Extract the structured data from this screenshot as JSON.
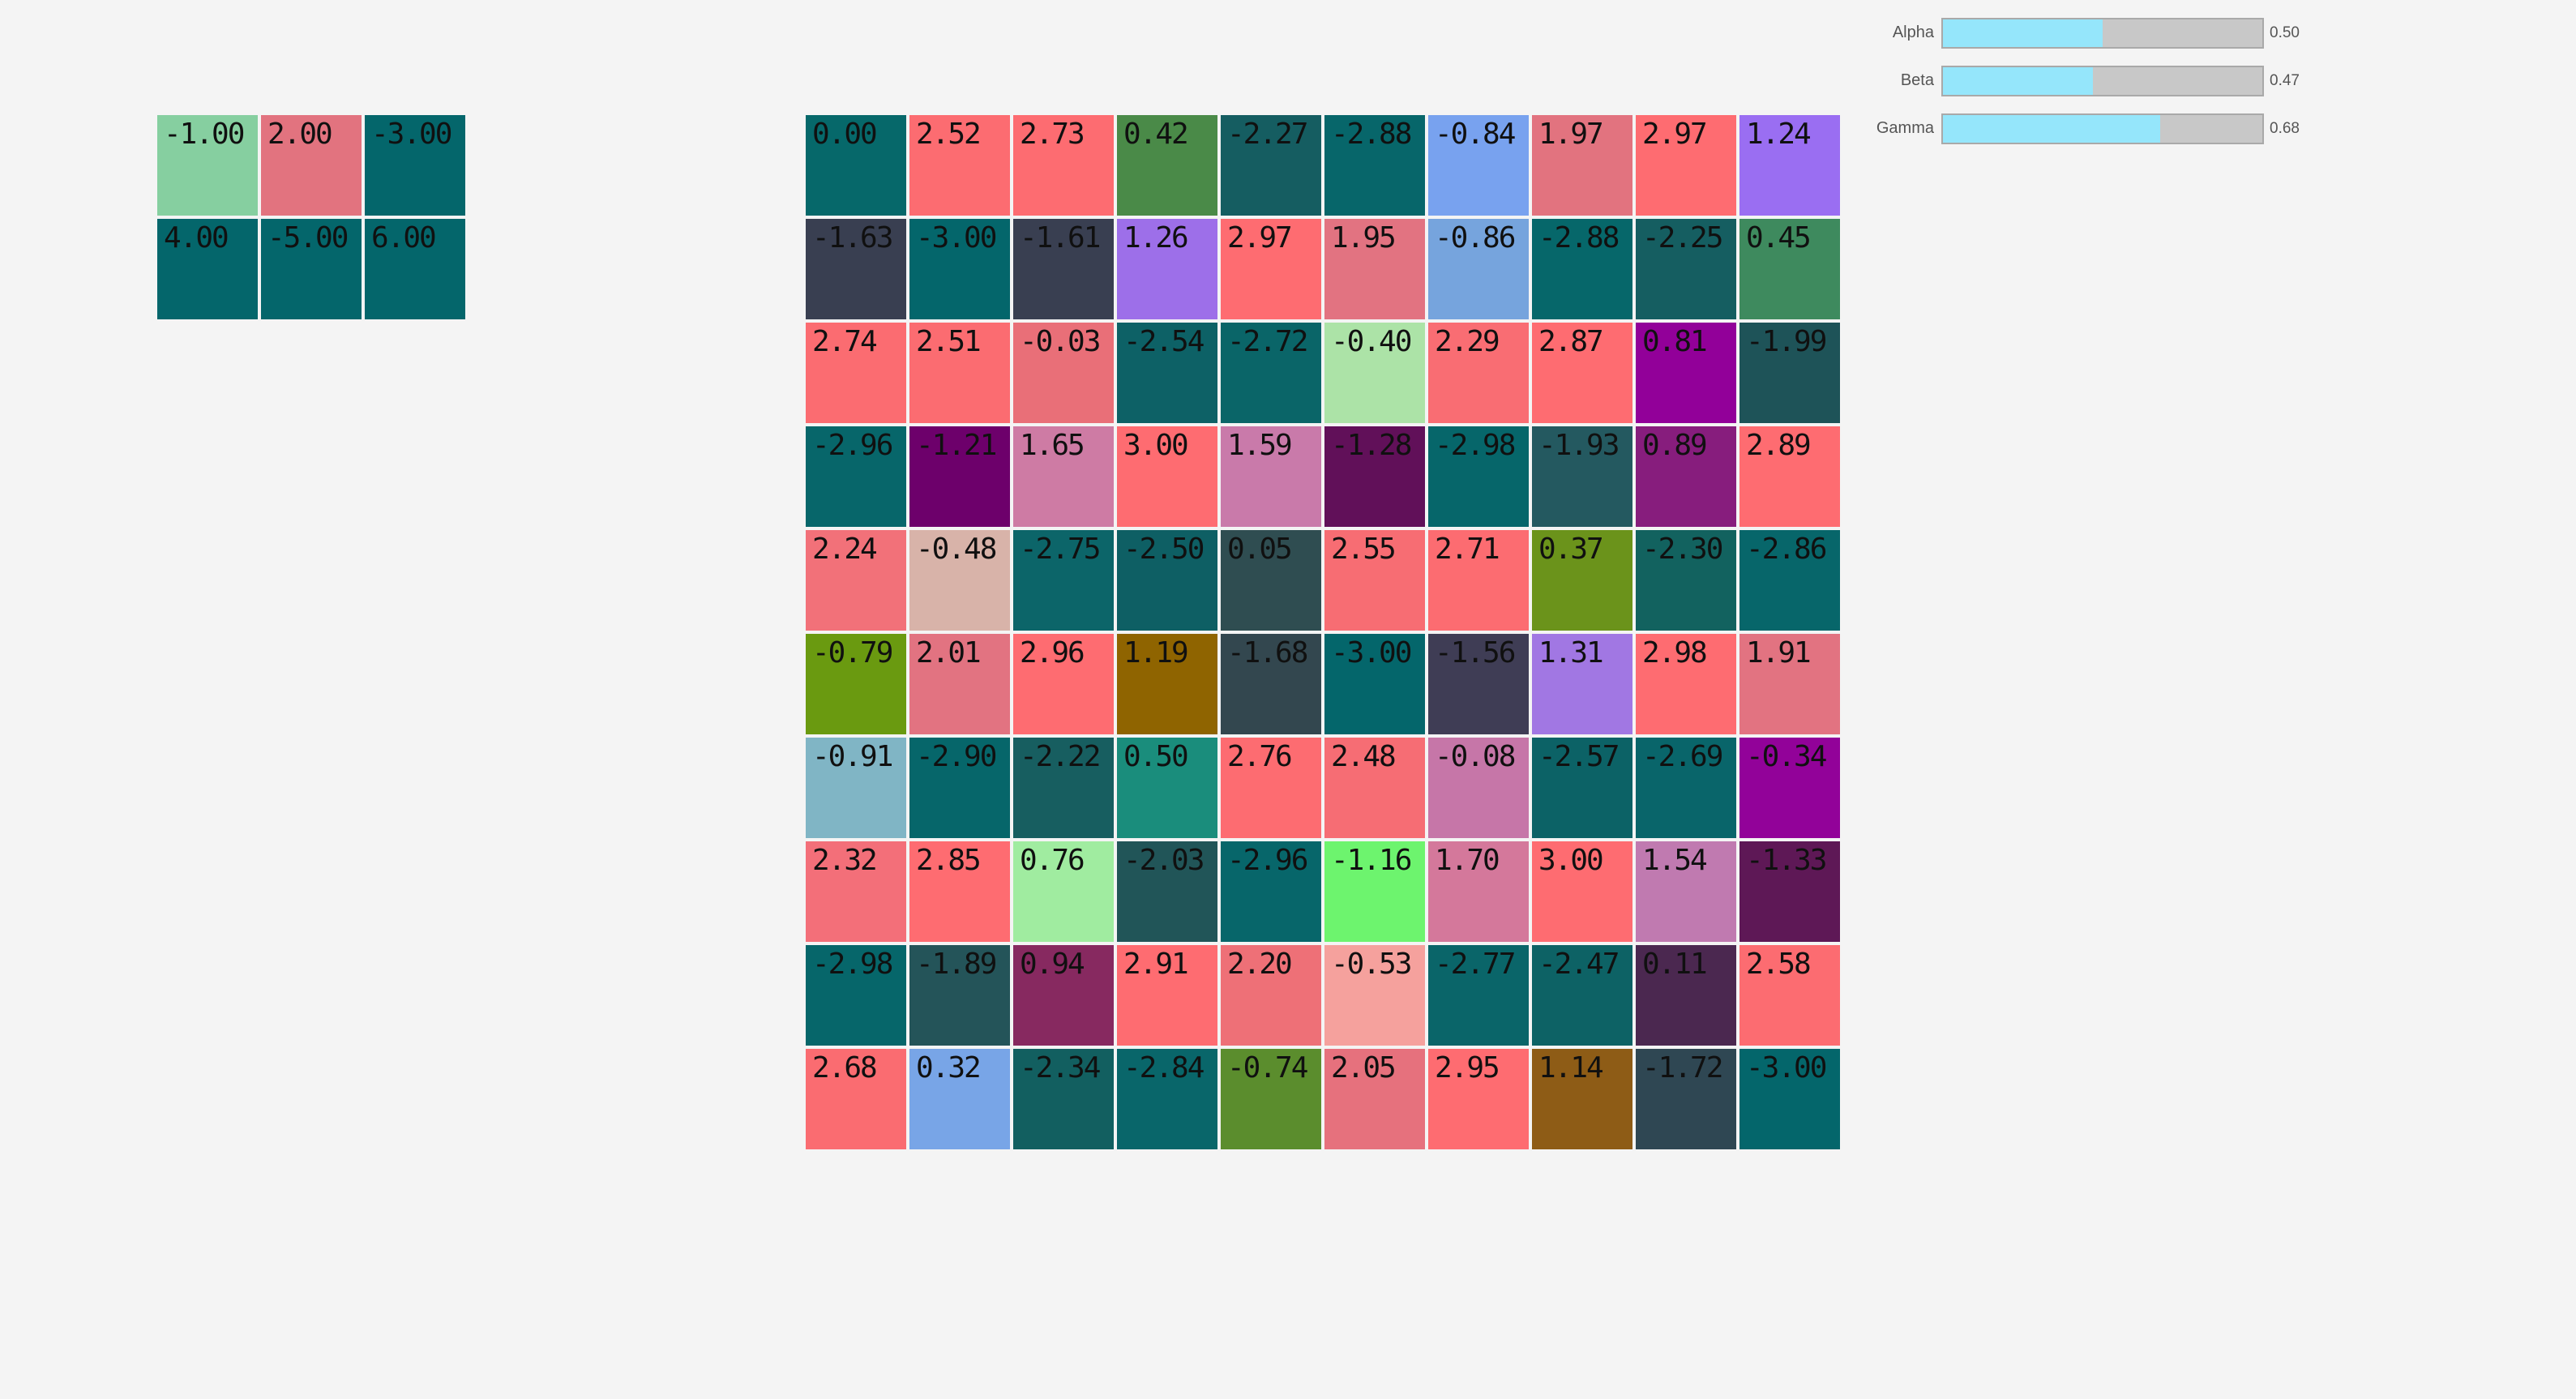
{
  "sliders": [
    {
      "label": "Alpha",
      "value_text": "0.50",
      "value": 0.5
    },
    {
      "label": "Beta",
      "value_text": "0.47",
      "value": 0.47
    },
    {
      "label": "Gamma",
      "value_text": "0.68",
      "value": 0.68
    }
  ],
  "small_matrix": {
    "rows": [
      [
        {
          "text": "-1.00",
          "color": "#86cfa0"
        },
        {
          "text": "2.00",
          "color": "#e2737f"
        },
        {
          "text": "-3.00",
          "color": "#04666b"
        }
      ],
      [
        {
          "text": "4.00",
          "color": "#04666b"
        },
        {
          "text": "-5.00",
          "color": "#04666b"
        },
        {
          "text": "6.00",
          "color": "#04666b"
        }
      ]
    ]
  },
  "big_matrix": {
    "rows": [
      [
        {
          "text": "0.00",
          "color": "#06686a"
        },
        {
          "text": "2.52",
          "color": "#fc6c71"
        },
        {
          "text": "2.73",
          "color": "#fd6c71"
        },
        {
          "text": "0.42",
          "color": "#4a8a48"
        },
        {
          "text": "-2.27",
          "color": "#155d61"
        },
        {
          "text": "-2.88",
          "color": "#07666a"
        },
        {
          "text": "-0.84",
          "color": "#78a2ef"
        },
        {
          "text": "1.97",
          "color": "#e2737f"
        },
        {
          "text": "2.97",
          "color": "#fe6c71"
        },
        {
          "text": "1.24",
          "color": "#9a6ef2"
        }
      ],
      [
        {
          "text": "-1.63",
          "color": "#393f51"
        },
        {
          "text": "-3.00",
          "color": "#04666b"
        },
        {
          "text": "-1.61",
          "color": "#393f51"
        },
        {
          "text": "1.26",
          "color": "#9d6fe9"
        },
        {
          "text": "2.97",
          "color": "#fe6c71"
        },
        {
          "text": "1.95",
          "color": "#e27381"
        },
        {
          "text": "-0.86",
          "color": "#76a4dd"
        },
        {
          "text": "-2.88",
          "color": "#06676a"
        },
        {
          "text": "-2.25",
          "color": "#155e61"
        },
        {
          "text": "0.45",
          "color": "#3e8a5e"
        }
      ],
      [
        {
          "text": "2.74",
          "color": "#fb6c71"
        },
        {
          "text": "2.51",
          "color": "#fb6c71"
        },
        {
          "text": "-0.03",
          "color": "#e96f78"
        },
        {
          "text": "-2.54",
          "color": "#0d6166"
        },
        {
          "text": "-2.72",
          "color": "#0a6568"
        },
        {
          "text": "-0.40",
          "color": "#ace3a7"
        },
        {
          "text": "2.29",
          "color": "#f96d73"
        },
        {
          "text": "2.87",
          "color": "#fe6c71"
        },
        {
          "text": "0.81",
          "color": "#920099"
        },
        {
          "text": "-1.99",
          "color": "#1e5358"
        }
      ],
      [
        {
          "text": "-2.96",
          "color": "#07666a"
        },
        {
          "text": "-1.21",
          "color": "#6d006b"
        },
        {
          "text": "1.65",
          "color": "#ce7ba4"
        },
        {
          "text": "3.00",
          "color": "#fe6c71"
        },
        {
          "text": "1.59",
          "color": "#c97aaa"
        },
        {
          "text": "-1.28",
          "color": "#611059"
        },
        {
          "text": "-2.98",
          "color": "#06666a"
        },
        {
          "text": "-1.93",
          "color": "#245960"
        },
        {
          "text": "0.89",
          "color": "#871d7d"
        },
        {
          "text": "2.89",
          "color": "#fe6c71"
        }
      ],
      [
        {
          "text": "2.24",
          "color": "#f27179"
        },
        {
          "text": "-0.48",
          "color": "#d8b3a9"
        },
        {
          "text": "-2.75",
          "color": "#0c6569"
        },
        {
          "text": "-2.50",
          "color": "#0e5f64"
        },
        {
          "text": "0.05",
          "color": "#2f4d51"
        },
        {
          "text": "2.55",
          "color": "#f76d73"
        },
        {
          "text": "2.71",
          "color": "#fc6c71"
        },
        {
          "text": "0.37",
          "color": "#6b931b"
        },
        {
          "text": "-2.30",
          "color": "#12625f"
        },
        {
          "text": "-2.86",
          "color": "#07666a"
        }
      ],
      [
        {
          "text": "-0.79",
          "color": "#6a9a10"
        },
        {
          "text": "2.01",
          "color": "#e27381"
        },
        {
          "text": "2.96",
          "color": "#fe6c71"
        },
        {
          "text": "1.19",
          "color": "#8f6400"
        },
        {
          "text": "-1.68",
          "color": "#33474f"
        },
        {
          "text": "-3.00",
          "color": "#04666b"
        },
        {
          "text": "-1.56",
          "color": "#3f3d55"
        },
        {
          "text": "1.31",
          "color": "#a177e3"
        },
        {
          "text": "2.98",
          "color": "#fe6c71"
        },
        {
          "text": "1.91",
          "color": "#e27381"
        }
      ],
      [
        {
          "text": "-0.91",
          "color": "#80b5c5"
        },
        {
          "text": "-2.90",
          "color": "#06666a"
        },
        {
          "text": "-2.22",
          "color": "#175e60"
        },
        {
          "text": "0.50",
          "color": "#1a8d7c"
        },
        {
          "text": "2.76",
          "color": "#fd6c71"
        },
        {
          "text": "2.48",
          "color": "#f66d74"
        },
        {
          "text": "-0.08",
          "color": "#c676a8"
        },
        {
          "text": "-2.57",
          "color": "#0c6266"
        },
        {
          "text": "-2.69",
          "color": "#09656a"
        },
        {
          "text": "-0.34",
          "color": "#920299"
        }
      ],
      [
        {
          "text": "2.32",
          "color": "#f36f79"
        },
        {
          "text": "2.85",
          "color": "#fe6c71"
        },
        {
          "text": "0.76",
          "color": "#a0eca0"
        },
        {
          "text": "-2.03",
          "color": "#215558"
        },
        {
          "text": "-2.96",
          "color": "#07666a"
        },
        {
          "text": "-1.16",
          "color": "#6df46e"
        },
        {
          "text": "1.70",
          "color": "#d4789b"
        },
        {
          "text": "3.00",
          "color": "#fe6c71"
        },
        {
          "text": "1.54",
          "color": "#c07ab0"
        },
        {
          "text": "-1.33",
          "color": "#5e1856"
        }
      ],
      [
        {
          "text": "-2.98",
          "color": "#06666a"
        },
        {
          "text": "-1.89",
          "color": "#245459"
        },
        {
          "text": "0.94",
          "color": "#872960"
        },
        {
          "text": "2.91",
          "color": "#fe6c71"
        },
        {
          "text": "2.20",
          "color": "#ee7077"
        },
        {
          "text": "-0.53",
          "color": "#f5a19d"
        },
        {
          "text": "-2.77",
          "color": "#0a6569"
        },
        {
          "text": "-2.47",
          "color": "#0d6265"
        },
        {
          "text": "0.11",
          "color": "#4b2850"
        },
        {
          "text": "2.58",
          "color": "#fc6c71"
        }
      ],
      [
        {
          "text": "2.68",
          "color": "#fa6c71"
        },
        {
          "text": "0.32",
          "color": "#78a5e7"
        },
        {
          "text": "-2.34",
          "color": "#125f60"
        },
        {
          "text": "-2.84",
          "color": "#09666a"
        },
        {
          "text": "-0.74",
          "color": "#5b8d2d"
        },
        {
          "text": "2.05",
          "color": "#e6717d"
        },
        {
          "text": "2.95",
          "color": "#fe6c71"
        },
        {
          "text": "1.14",
          "color": "#8e5c16"
        },
        {
          "text": "-1.72",
          "color": "#2f4753"
        },
        {
          "text": "-3.00",
          "color": "#04666b"
        }
      ]
    ]
  }
}
